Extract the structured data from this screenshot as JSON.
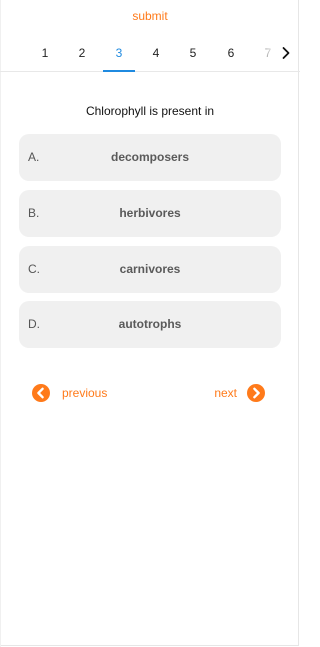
{
  "header": {
    "submit_label": "submit"
  },
  "tabs": {
    "items": [
      "1",
      "2",
      "3",
      "4",
      "5",
      "6",
      "7"
    ],
    "active": "3",
    "scroll_icon": "chevron-right-icon"
  },
  "question": {
    "text": "Chlorophyll is present in"
  },
  "options": [
    {
      "letter": "A.",
      "text": "decomposers"
    },
    {
      "letter": "B.",
      "text": "herbivores"
    },
    {
      "letter": "C.",
      "text": "carnivores"
    },
    {
      "letter": "D.",
      "text": "autotrophs"
    }
  ],
  "navigation": {
    "previous_label": "previous",
    "next_label": "next",
    "previous_icon": "chevron-left-circle-icon",
    "next_icon": "chevron-right-circle-icon"
  },
  "colors": {
    "accent": "#ff7a1a",
    "active_tab": "#1f8ae0",
    "option_background": "#f0f0f0"
  }
}
